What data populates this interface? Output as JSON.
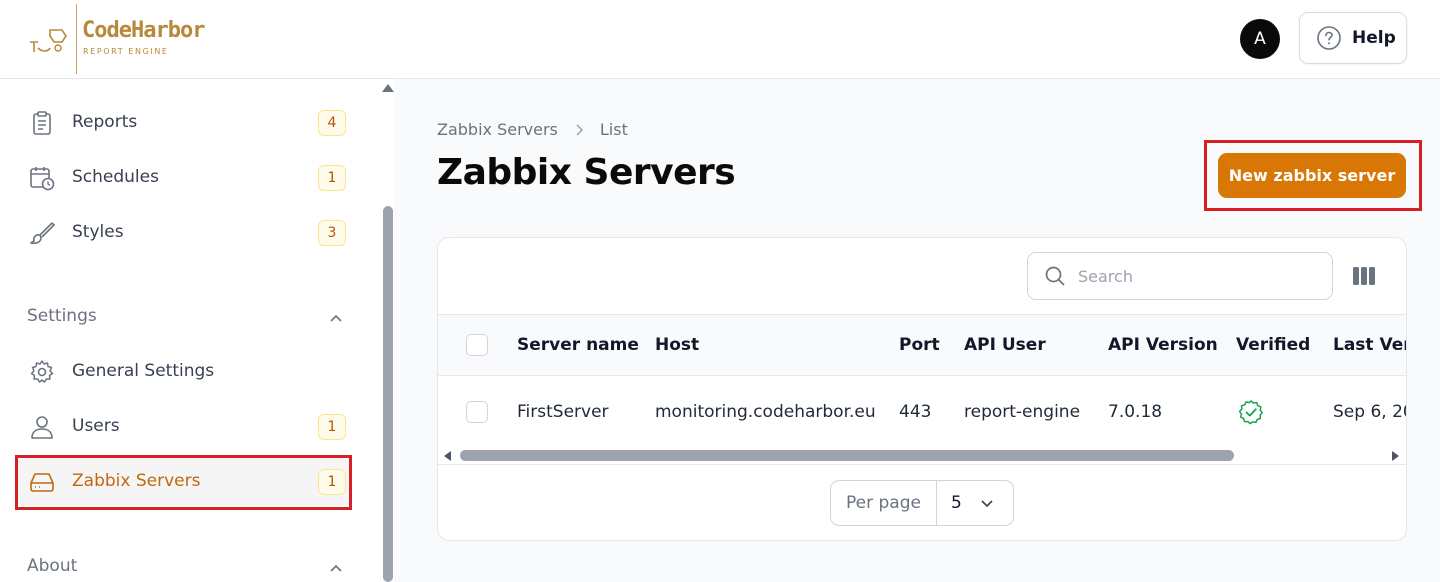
{
  "app": {
    "brand": "CodeHarbor",
    "brand_sub": "REPORT ENGINE",
    "avatar_initial": "A",
    "help_label": "Help"
  },
  "sidebar": {
    "items": [
      {
        "label": "Reports",
        "badge": "4",
        "icon": "clipboard-icon"
      },
      {
        "label": "Schedules",
        "badge": "1",
        "icon": "calendar-clock-icon"
      },
      {
        "label": "Styles",
        "badge": "3",
        "icon": "paintbrush-icon"
      }
    ],
    "settings": {
      "title": "Settings",
      "items": [
        {
          "label": "General Settings",
          "icon": "gear-icon"
        },
        {
          "label": "Users",
          "badge": "1",
          "icon": "user-icon"
        },
        {
          "label": "Zabbix Servers",
          "badge": "1",
          "icon": "server-icon",
          "active": true
        }
      ]
    },
    "about": {
      "title": "About"
    }
  },
  "main": {
    "breadcrumb": [
      "Zabbix Servers",
      "List"
    ],
    "title": "Zabbix Servers",
    "new_button": "New zabbix server",
    "search_placeholder": "Search",
    "columns": [
      "Server name",
      "Host",
      "Port",
      "API User",
      "API Version",
      "Verified",
      "Last Veri"
    ],
    "rows": [
      {
        "server_name": "FirstServer",
        "host": "monitoring.codeharbor.eu",
        "port": "443",
        "api_user": "report-engine",
        "api_version": "7.0.18",
        "verified": true,
        "last_verified": "Sep 6, 20"
      }
    ],
    "per_page_label": "Per page",
    "per_page_value": "5"
  },
  "colors": {
    "accent": "#d97706",
    "active_text": "#c2680d",
    "highlight": "#d71f26",
    "verified": "#16a34a"
  }
}
